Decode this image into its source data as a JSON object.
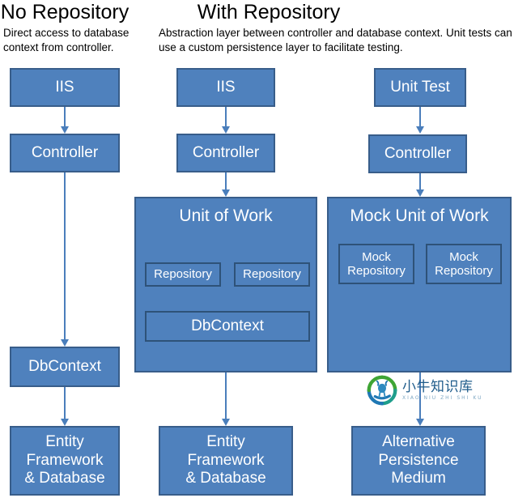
{
  "columns": [
    {
      "title": "No Repository",
      "description": "Direct access to database context from controller."
    },
    {
      "title": "With Repository",
      "description": "Abstraction layer between controller and database context. Unit tests can use a custom persistence layer to facilitate testing."
    }
  ],
  "flow_left": {
    "iis": "IIS",
    "controller": "Controller",
    "dbcontext": "DbContext",
    "sink": "Entity\nFramework\n& Database",
    "sink_lines": [
      "Entity",
      "Framework",
      "& Database"
    ]
  },
  "flow_middle": {
    "iis": "IIS",
    "controller": "Controller",
    "unit_of_work": "Unit of Work",
    "repository_left": "Repository",
    "repository_right": "Repository",
    "dbcontext": "DbContext",
    "sink_lines": [
      "Entity",
      "Framework",
      "& Database"
    ]
  },
  "flow_right": {
    "unit_test": "Unit Test",
    "controller": "Controller",
    "mock_unit_of_work": "Mock Unit of Work",
    "mock_repository_left_lines": [
      "Mock",
      "Repository"
    ],
    "mock_repository_right_lines": [
      "Mock",
      "Repository"
    ],
    "sink_lines": [
      "Alternative",
      "Persistence",
      "Medium"
    ]
  },
  "watermark": {
    "title": "小牛知识库",
    "pinyin": "XIAO NIU ZHI SHI KU"
  },
  "colors": {
    "node_fill": "#4F81BD",
    "node_border": "#385D8A",
    "inner_border": "#2E5278",
    "arrow": "#4A7EBB",
    "text_on_node": "#FFFFFF",
    "heading": "#000000",
    "watermark_green": "#3FA535",
    "watermark_blue": "#1F78B4"
  }
}
